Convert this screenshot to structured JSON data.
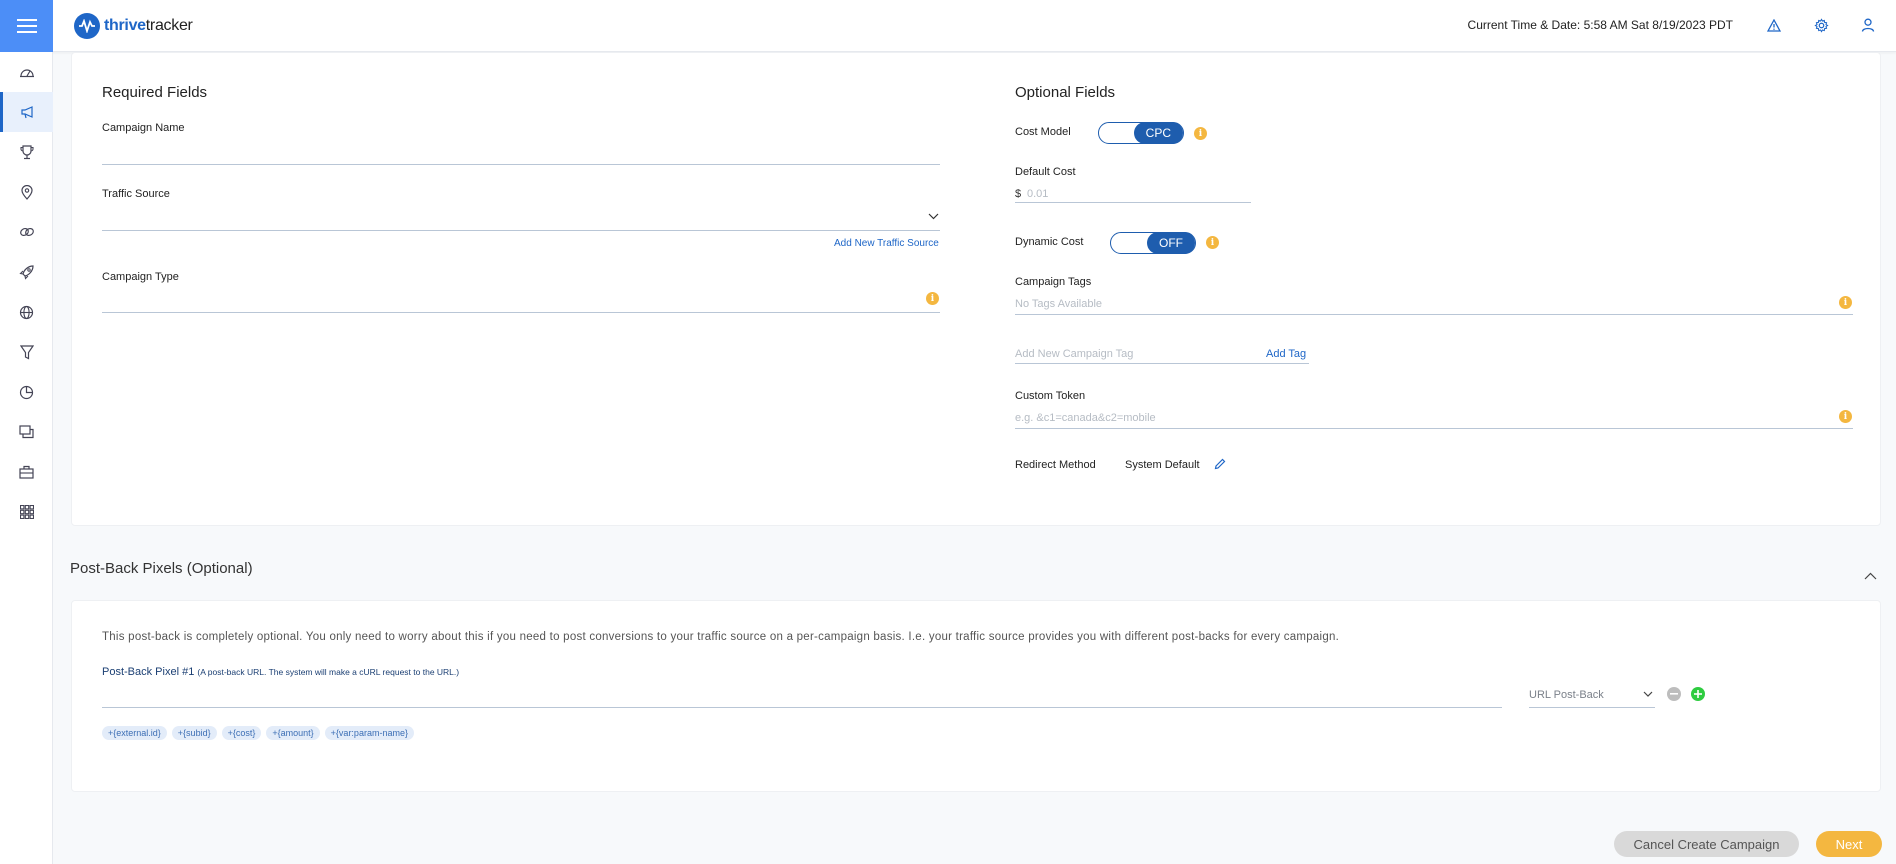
{
  "app": {
    "logo_thrive": "thrive",
    "logo_tracker": "tracker",
    "clock": "Current Time & Date: 5:58 AM Sat 8/19/2023 PDT"
  },
  "sidebar": {
    "items": [
      {
        "icon": "dashboard-icon"
      },
      {
        "icon": "megaphone-icon",
        "active": true
      },
      {
        "icon": "trophy-icon"
      },
      {
        "icon": "location-pin-icon"
      },
      {
        "icon": "link-icon"
      },
      {
        "icon": "rocket-icon"
      },
      {
        "icon": "globe-icon"
      },
      {
        "icon": "filter-icon"
      },
      {
        "icon": "pie-chart-icon"
      },
      {
        "icon": "windows-icon"
      },
      {
        "icon": "briefcase-icon"
      },
      {
        "icon": "apps-grid-icon"
      }
    ]
  },
  "required": {
    "title": "Required Fields",
    "campaign_name_label": "Campaign Name",
    "traffic_source_label": "Traffic Source",
    "add_traffic_source": "Add New Traffic Source",
    "campaign_type_label": "Campaign Type"
  },
  "optional": {
    "title": "Optional Fields",
    "cost_model_label": "Cost Model",
    "cost_model_value": "CPC",
    "default_cost_label": "Default Cost",
    "currency": "$",
    "default_cost_placeholder": "0.01",
    "dynamic_cost_label": "Dynamic Cost",
    "dynamic_cost_value": "OFF",
    "campaign_tags_label": "Campaign Tags",
    "tags_placeholder": "No Tags Available",
    "new_tag_placeholder": "Add New Campaign Tag",
    "add_tag": "Add Tag",
    "custom_token_label": "Custom Token",
    "custom_token_placeholder": "e.g. &c1=canada&c2=mobile",
    "redirect_label": "Redirect Method",
    "redirect_value": "System Default"
  },
  "postback": {
    "title": "Post-Back Pixels (Optional)",
    "description": "This post-back is completely optional. You only need to worry about this if you need to post conversions to your traffic source on a per-campaign basis. I.e. your traffic source provides you with different post-backs for every campaign.",
    "pixel_label": "Post-Back Pixel #1",
    "pixel_hint": "(A post-back URL. The system will make a cURL request to the URL.)",
    "type_value": "URL Post-Back",
    "tokens": [
      "+{external.id}",
      "+{subid}",
      "+{cost}",
      "+{amount}",
      "+{var:param-name}"
    ]
  },
  "footer": {
    "cancel": "Cancel Create Campaign",
    "next": "Next"
  },
  "colors": {
    "primary": "#1e66c7",
    "hamburger_bg": "#4c8ef7",
    "info": "#f4b740",
    "next_btn": "#f4b740",
    "add_green": "#2ecc40"
  }
}
